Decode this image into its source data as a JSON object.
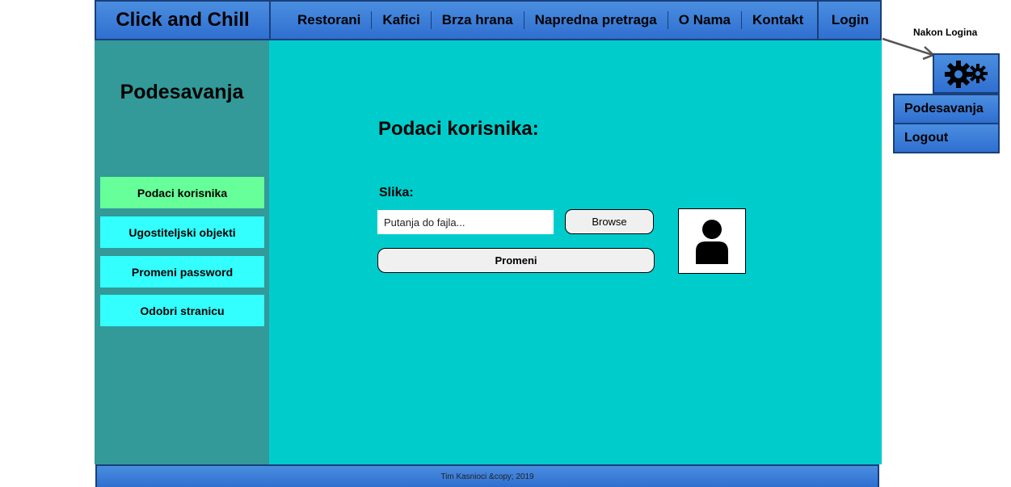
{
  "header": {
    "brand": "Click and Chill",
    "nav": [
      "Restorani",
      "Kafici",
      "Brza hrana",
      "Napredna pretraga",
      "O Nama",
      "Kontakt"
    ],
    "login": "Login"
  },
  "sidebar": {
    "title": "Podesavanja",
    "items": [
      {
        "label": "Podaci korisnika",
        "active": true
      },
      {
        "label": "Ugostiteljski objekti",
        "active": false
      },
      {
        "label": "Promeni password",
        "active": false
      },
      {
        "label": "Odobri stranicu",
        "active": false
      }
    ]
  },
  "main": {
    "title": "Podaci korisnika:",
    "image_label": "Slika:",
    "file_placeholder": "Putanja do fajla...",
    "browse": "Browse",
    "change": "Promeni",
    "avatar_icon": "user-icon"
  },
  "footer": {
    "text": "Tim Kasnioci &copy; 2019"
  },
  "annotation": {
    "note": "Nakon Logina",
    "gear_icon": "gears-icon",
    "menu": [
      "Podesavanja",
      "Logout"
    ]
  },
  "colors": {
    "header": "#3b7fd8",
    "sidebar": "#339999",
    "main": "#00cccc",
    "side_button": "#33ffff",
    "side_button_active": "#66ff99"
  }
}
